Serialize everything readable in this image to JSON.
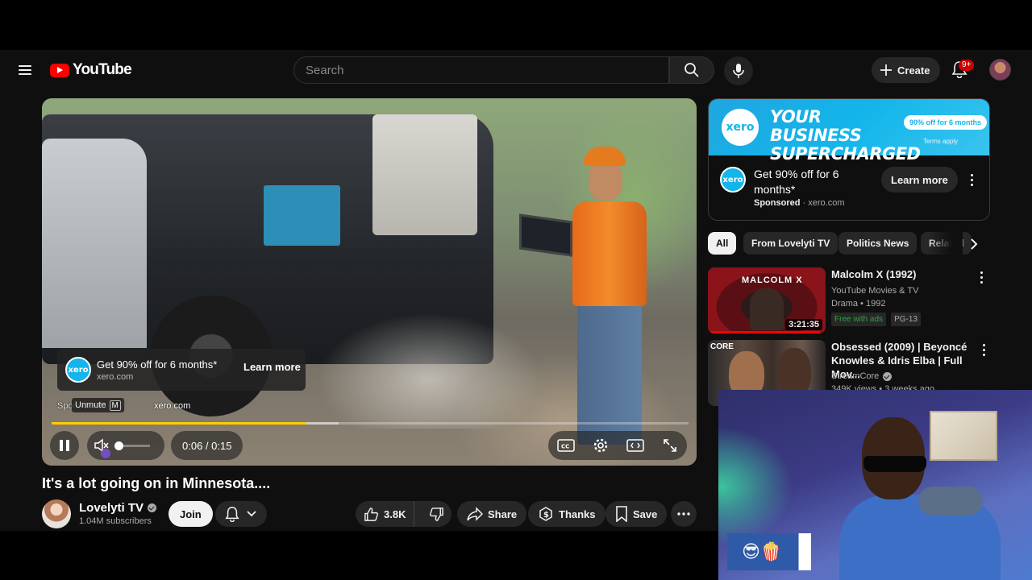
{
  "header": {
    "logo_text": "YouTube",
    "search_placeholder": "Search",
    "create_label": "Create",
    "notification_count": "9+"
  },
  "player": {
    "ad_card": {
      "title": "Get 90% off for 6 months*",
      "domain": "xero.com",
      "button": "Learn more"
    },
    "sponsor_line": "Sponsored 1 of 2",
    "sponsor_domain": "xero.com",
    "unmute_tooltip": "Unmute",
    "unmute_key": "M",
    "time_display": "0:06 / 0:15",
    "progress_fraction": 0.4,
    "buffered_fraction": 0.45,
    "volume_fraction": 0.0,
    "logo_text": "xero"
  },
  "video": {
    "title": "It's a lot going on in Minnesota....",
    "channel_name": "Lovelyti TV",
    "subscribers": "1.04M subscribers",
    "join_label": "Join",
    "likes": "3.8K",
    "share_label": "Share",
    "thanks_label": "Thanks",
    "save_label": "Save"
  },
  "sidebar_ad": {
    "logo_text": "xero",
    "banner_headline": "YOUR BUSINESS SUPERCHARGED",
    "banner_pill": "90% off for 6 months",
    "banner_terms": "Terms apply",
    "title": "Get 90% off for 6 months*",
    "sponsored_label": "Sponsored",
    "separator": "·",
    "domain": "xero.com",
    "button": "Learn more"
  },
  "chips": [
    "All",
    "From Lovelyti TV",
    "Politics News",
    "Related"
  ],
  "recommendations": [
    {
      "title": "Malcolm X (1992)",
      "channel": "YouTube Movies & TV",
      "meta": "Drama • 1992",
      "duration": "3:21:35",
      "thumb_text": "MALCOLM X",
      "tags": [
        "Free with ads",
        "PG-13"
      ],
      "watched_fraction": 0.95
    },
    {
      "title": "Obsessed (2009) | Beyoncé Knowles & Idris Elba | Full Mov...",
      "channel": "StreamCore",
      "meta": "349K views • 3 weeks ago",
      "thumb_text": "CORE"
    }
  ],
  "webcam": {
    "emoji": "😎🍿"
  },
  "colors": {
    "background": "#0f0f0f",
    "progress": "#ffcc00",
    "youtube_red": "#ff0000",
    "xero_blue": "#13b5ea"
  }
}
